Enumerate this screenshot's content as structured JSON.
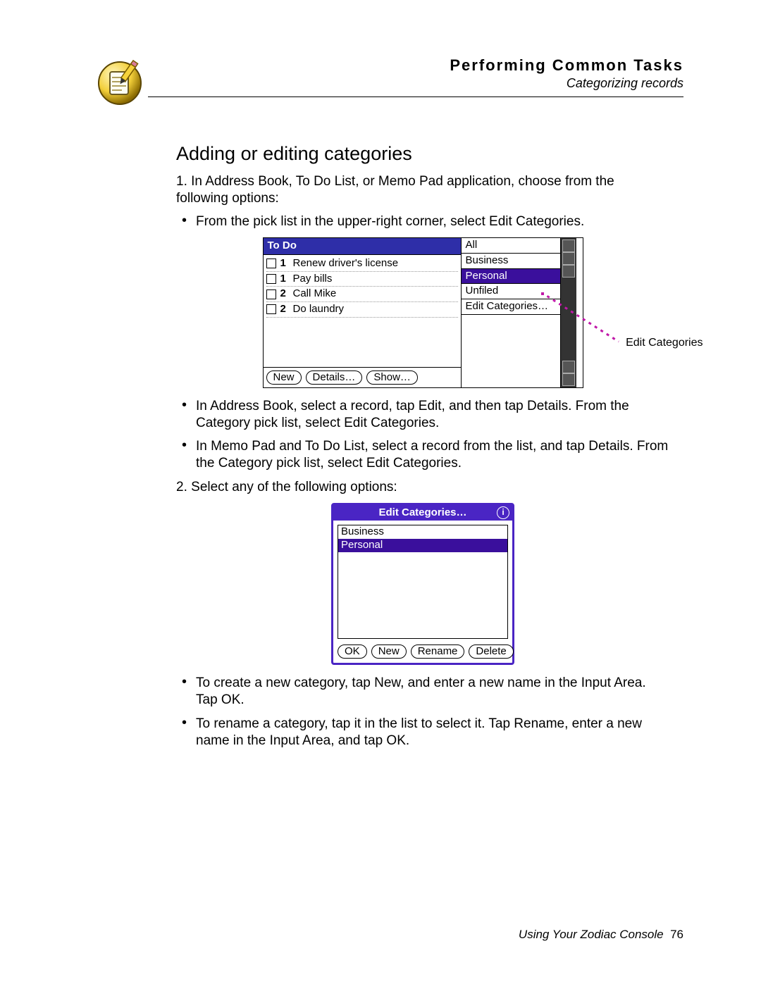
{
  "header": {
    "chapter": "Performing Common Tasks",
    "section": "Categorizing records"
  },
  "heading": "Adding or editing categories",
  "step1": {
    "num": "1.",
    "intro": "In Address Book, To Do List, or Memo Pad application, choose from the following options:",
    "bullet_a": "From the pick list in the upper-right corner, select Edit Categories.",
    "bullet_b": "In Address Book, select a record, tap Edit, and then tap Details. From the Category pick list, select Edit Categories.",
    "bullet_c": "In Memo Pad and To Do List, select a record from the list, and tap Details. From the Category pick list, select Edit Categories."
  },
  "step2": {
    "num": "2.",
    "intro": "Select any of the following options:",
    "bullet_a": "To create a new category, tap New, and enter a new name in the Input Area. Tap OK.",
    "bullet_b": "To rename a category, tap it in the list to select it. Tap Rename, enter a new name in the Input Area, and tap OK."
  },
  "fig1": {
    "title": "To Do",
    "items": [
      {
        "pri": "1",
        "text": "Renew driver's license"
      },
      {
        "pri": "1",
        "text": "Pay bills"
      },
      {
        "pri": "2",
        "text": "Call Mike"
      },
      {
        "pri": "2",
        "text": "Do laundry"
      }
    ],
    "buttons": {
      "new": "New",
      "details": "Details…",
      "show": "Show…"
    },
    "picklist": {
      "all": "All",
      "business": "Business",
      "personal": "Personal",
      "unfiled": "Unfiled",
      "edit": "Edit Categories…"
    },
    "callout": "Edit Categories"
  },
  "fig2": {
    "title": "Edit Categories…",
    "rows": {
      "business": "Business",
      "personal": "Personal"
    },
    "buttons": {
      "ok": "OK",
      "new": "New",
      "rename": "Rename",
      "delete": "Delete"
    }
  },
  "footer": {
    "book": "Using Your Zodiac Console",
    "page": "76"
  }
}
